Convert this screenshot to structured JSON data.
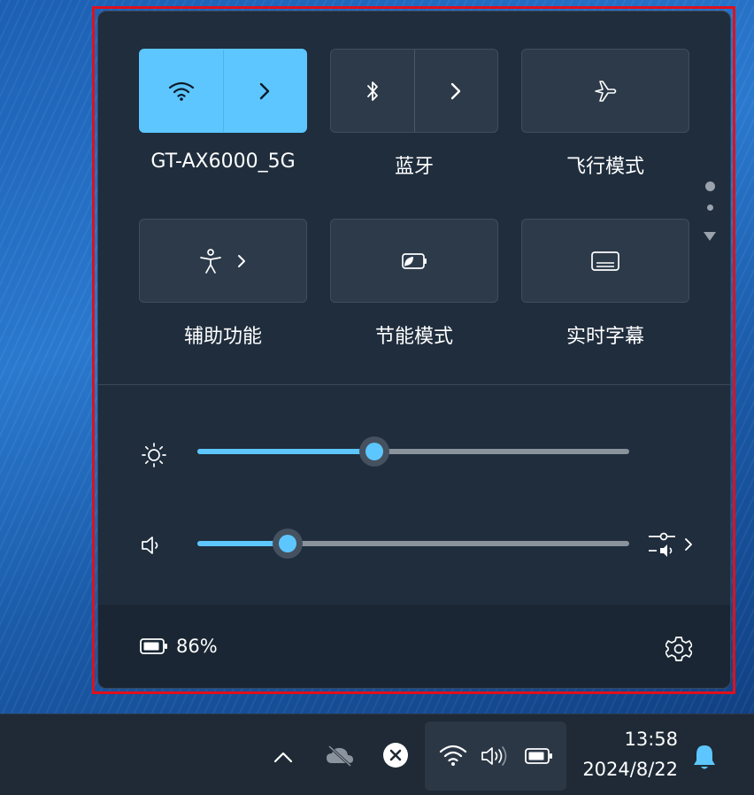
{
  "quick_settings": {
    "tiles": [
      {
        "id": "wifi",
        "label": "GT-AX6000_5G",
        "active": true
      },
      {
        "id": "bluetooth",
        "label": "蓝牙",
        "active": false
      },
      {
        "id": "airplane",
        "label": "飞行模式",
        "active": false
      },
      {
        "id": "accessibility",
        "label": "辅助功能",
        "active": false
      },
      {
        "id": "energy_saver",
        "label": "节能模式",
        "active": false
      },
      {
        "id": "live_captions",
        "label": "实时字幕",
        "active": false
      }
    ],
    "brightness": {
      "value": 0.41,
      "icon": "sun-icon"
    },
    "volume": {
      "value": 0.21,
      "icon": "speaker-icon"
    },
    "battery_percent": "86%"
  },
  "taskbar": {
    "time": "13:58",
    "date": "2024/8/22"
  },
  "colors": {
    "accent": "#5dc6ff",
    "panel": "#1f2d3d",
    "highlight": "#e0101c"
  }
}
